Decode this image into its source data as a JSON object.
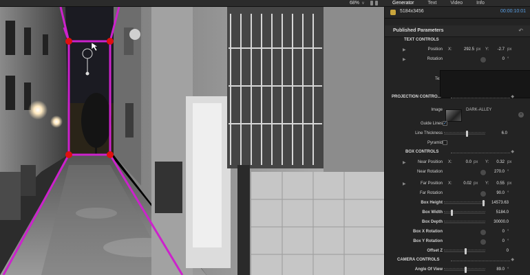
{
  "topbar": {
    "zoom": "68%",
    "zoom_chevron": "v",
    "tabs": [
      "Generator",
      "Text",
      "Video",
      "Info"
    ]
  },
  "viewer": {
    "image_name": "DARK-ALLEY",
    "guide_color": "#cc22cc",
    "handle_color": "#e01010"
  },
  "inspector": {
    "dimensions": "5184x3456",
    "timecode": "00:00:10:01",
    "published_label": "Published Parameters",
    "reset_glyph": "↶",
    "text_controls": {
      "label": "TEXT CONTROLS",
      "position_label": "Position",
      "pos_x_axis": "X:",
      "pos_x": "292.5",
      "pos_x_unit": "px",
      "pos_y_axis": "Y:",
      "pos_y": "-2.7",
      "pos_y_unit": "px",
      "rotation_label": "Rotation",
      "rotation": "0",
      "rotation_unit": "°",
      "text_label": "Text"
    },
    "projection": {
      "label": "PROJECTION CONTRO...",
      "image_label": "Image",
      "image_value": "DARK-ALLEY",
      "clear_glyph": "×",
      "guide_lines_label": "Guide Lines",
      "guide_lines_checked": "✓",
      "line_thickness_label": "Line Thickness",
      "line_thickness": "6.0",
      "pyramid_label": "Pyramid"
    },
    "box_controls": {
      "label": "BOX CONTROLS",
      "near_position_label": "Near Position",
      "near_x_axis": "X:",
      "near_x": "0.0",
      "near_x_unit": "px",
      "near_y_axis": "Y:",
      "near_y": "0.32",
      "near_y_unit": "px",
      "near_rotation_label": "Near Rotation",
      "near_rotation": "270.0",
      "near_rotation_unit": "°",
      "far_position_label": "Far Position",
      "far_x_axis": "X:",
      "far_x": "0.02",
      "far_x_unit": "px",
      "far_y_axis": "Y:",
      "far_y": "0.55",
      "far_y_unit": "px",
      "far_rotation_label": "Far Rotation",
      "far_rotation": "90.0",
      "far_rotation_unit": "°",
      "box_height_label": "Box Height",
      "box_height": "14573.63",
      "box_width_label": "Box Width",
      "box_width": "5184.0",
      "box_depth_label": "Box Depth",
      "box_depth": "30000.0",
      "box_x_rotation_label": "Box X Rotation",
      "box_x_rotation": "0",
      "box_x_rotation_unit": "°",
      "box_y_rotation_label": "Box Y Rotation",
      "box_y_rotation": "0",
      "box_y_rotation_unit": "°",
      "offset_z_label": "Offset Z",
      "offset_z": "0"
    },
    "camera_controls": {
      "label": "CAMERA CONTROLS",
      "angle_of_view_label": "Angle Of View",
      "angle_of_view": "89.0",
      "angle_of_view_unit": "°"
    }
  }
}
